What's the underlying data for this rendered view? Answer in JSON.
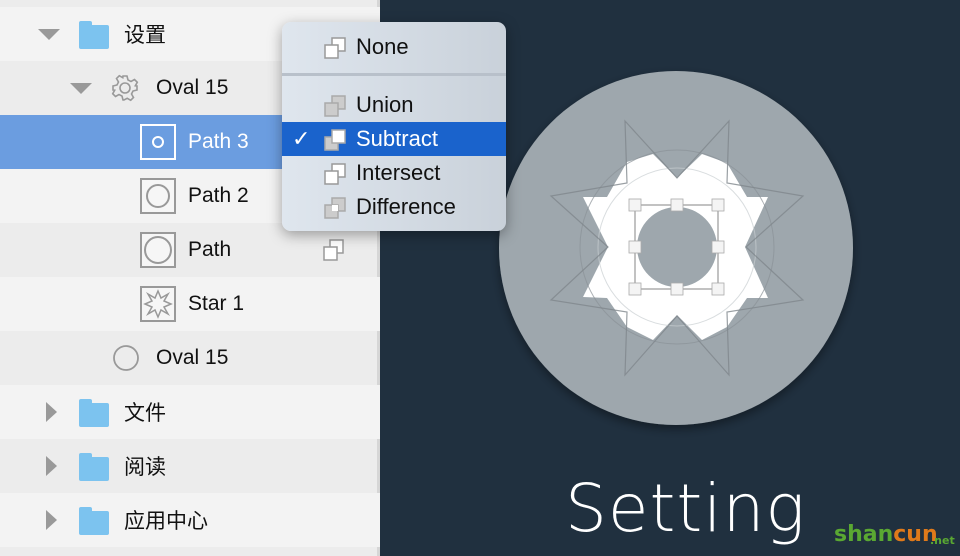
{
  "layers": [
    {
      "label": "设置",
      "type": "folder",
      "expanded": true
    },
    {
      "label": "Oval 15",
      "type": "group",
      "expanded": true
    },
    {
      "label": "Path 3",
      "type": "path",
      "selected": true
    },
    {
      "label": "Path 2",
      "type": "path"
    },
    {
      "label": "Path",
      "type": "path"
    },
    {
      "label": "Star 1",
      "type": "star"
    },
    {
      "label": "Oval 15",
      "type": "oval"
    },
    {
      "label": "文件",
      "type": "folder",
      "expanded": false
    },
    {
      "label": "阅读",
      "type": "folder",
      "expanded": false
    },
    {
      "label": "应用中心",
      "type": "folder",
      "expanded": false
    }
  ],
  "boolean_menu": {
    "items": [
      {
        "label": "None",
        "icon": "boolean-none-icon"
      },
      {
        "label": "Union",
        "icon": "boolean-union-icon"
      },
      {
        "label": "Subtract",
        "icon": "boolean-subtract-icon",
        "checked": true
      },
      {
        "label": "Intersect",
        "icon": "boolean-intersect-icon"
      },
      {
        "label": "Difference",
        "icon": "boolean-difference-icon"
      }
    ],
    "check_mark": "✓"
  },
  "canvas": {
    "title": "Setting",
    "background": "#20303f",
    "circle_color": "#9ea7ad"
  },
  "watermark": {
    "text1": "shan",
    "text2": "cun",
    "text3": ".net"
  },
  "colors": {
    "selection": "#6b9de0",
    "menu_highlight": "#1a63cc"
  }
}
